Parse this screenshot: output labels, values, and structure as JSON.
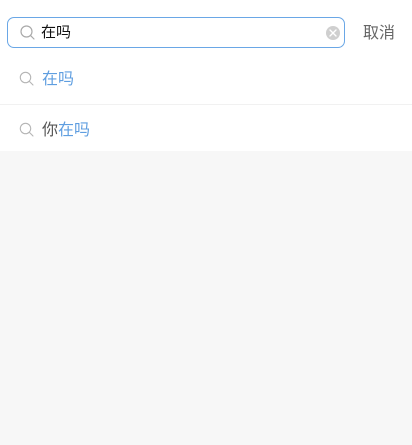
{
  "search": {
    "query": "在吗",
    "cancel_label": "取消"
  },
  "suggestions": [
    {
      "prefix": "",
      "match": "在吗"
    },
    {
      "prefix": "你",
      "match": "在吗"
    }
  ],
  "colors": {
    "accent": "#5f9ee0",
    "border": "#6aa7e6",
    "background": "#f7f7f7"
  }
}
